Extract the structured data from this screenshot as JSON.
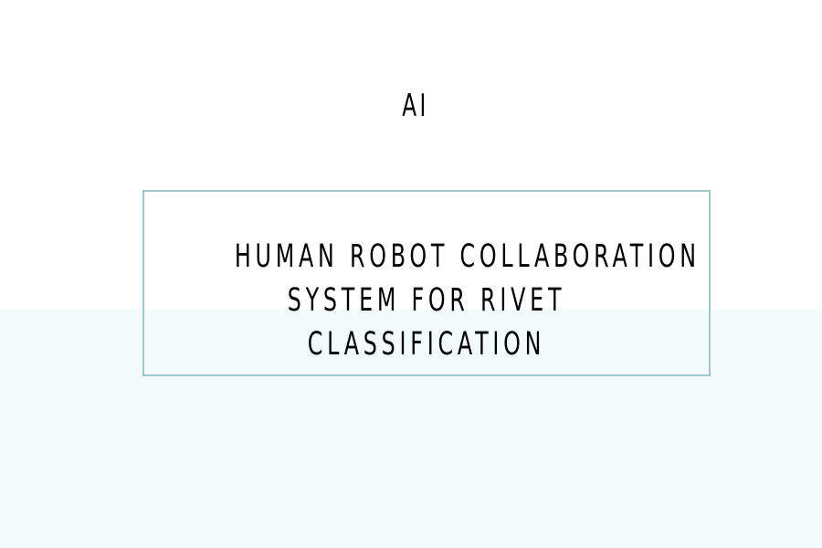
{
  "category": "AI",
  "title": {
    "lines": [
      "HUMAN ROBOT COLLABORATION",
      "SYSTEM FOR RIVET",
      "CLASSIFICATION"
    ]
  },
  "colors": {
    "background": "#ffffff",
    "band": "#f3fbfa",
    "border": "#9fc6cc",
    "text": "#000000"
  }
}
